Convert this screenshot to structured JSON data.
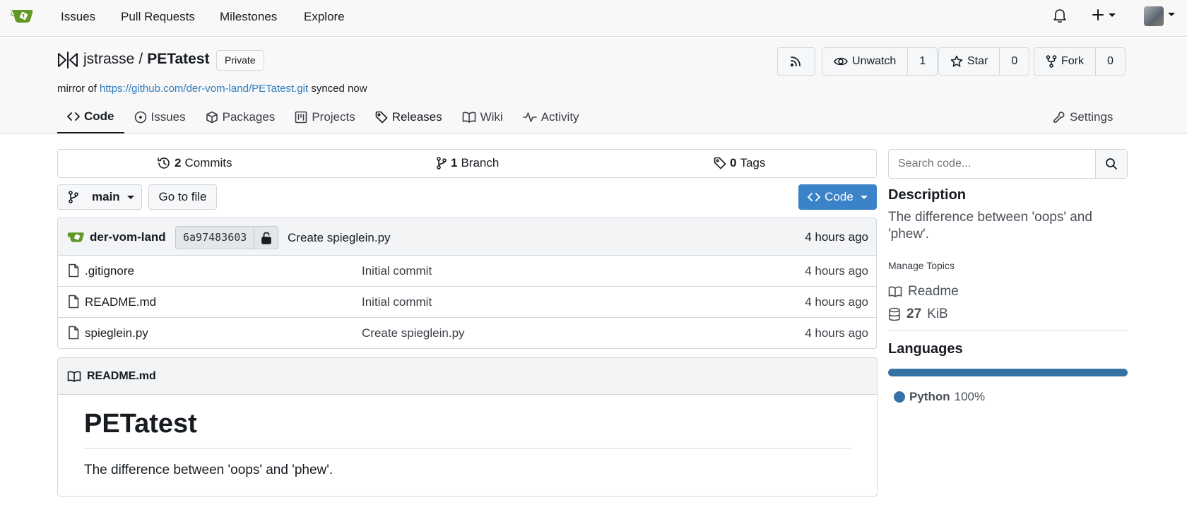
{
  "topnav": {
    "links": [
      "Issues",
      "Pull Requests",
      "Milestones",
      "Explore"
    ],
    "logo_icon": "gitea-logo-icon",
    "bell_icon": "bell-icon",
    "plus_icon": "plus-icon",
    "avatar": "user-avatar"
  },
  "repo": {
    "owner": "jstrasse",
    "separator": "/",
    "name": "PETatest",
    "visibility": "Private",
    "mirror_prefix": "mirror of",
    "mirror_url": "https://github.com/der-vom-land/PETatest.git",
    "mirror_suffix": "synced now",
    "actions": {
      "unwatch_label": "Unwatch",
      "unwatch_count": "1",
      "star_label": "Star",
      "star_count": "0",
      "fork_label": "Fork",
      "fork_count": "0"
    }
  },
  "tabs": {
    "code": "Code",
    "issues": "Issues",
    "packages": "Packages",
    "projects": "Projects",
    "releases": "Releases",
    "wiki": "Wiki",
    "activity": "Activity",
    "settings": "Settings"
  },
  "stats": {
    "commits_count": "2",
    "commits_label": "Commits",
    "branch_count": "1",
    "branch_label": "Branch",
    "tags_count": "0",
    "tags_label": "Tags"
  },
  "toolbar": {
    "branch": "main",
    "goto_file": "Go to file",
    "code_button": "Code"
  },
  "latest_commit": {
    "author": "der-vom-land",
    "sha": "6a97483603",
    "message": "Create spieglein.py",
    "time": "4 hours ago"
  },
  "files": [
    {
      "name": ".gitignore",
      "message": "Initial commit",
      "time": "4 hours ago"
    },
    {
      "name": "README.md",
      "message": "Initial commit",
      "time": "4 hours ago"
    },
    {
      "name": "spieglein.py",
      "message": "Create spieglein.py",
      "time": "4 hours ago"
    }
  ],
  "readme": {
    "filename": "README.md",
    "heading": "PETatest",
    "text": "The difference between 'oops' and 'phew'."
  },
  "sidebar": {
    "search_placeholder": "Search code...",
    "description_heading": "Description",
    "description": "The difference between 'oops' and 'phew'.",
    "manage_topics": "Manage Topics",
    "readme_link": "Readme",
    "size_value": "27",
    "size_unit": "KiB",
    "languages_heading": "Languages",
    "languages": [
      {
        "name": "Python",
        "percent": "100%",
        "color": "#3572a5"
      }
    ]
  },
  "colors": {
    "accent": "#3b83c8",
    "link": "#2f7cbd",
    "python": "#3572a5",
    "gitea_green": "#609926"
  }
}
